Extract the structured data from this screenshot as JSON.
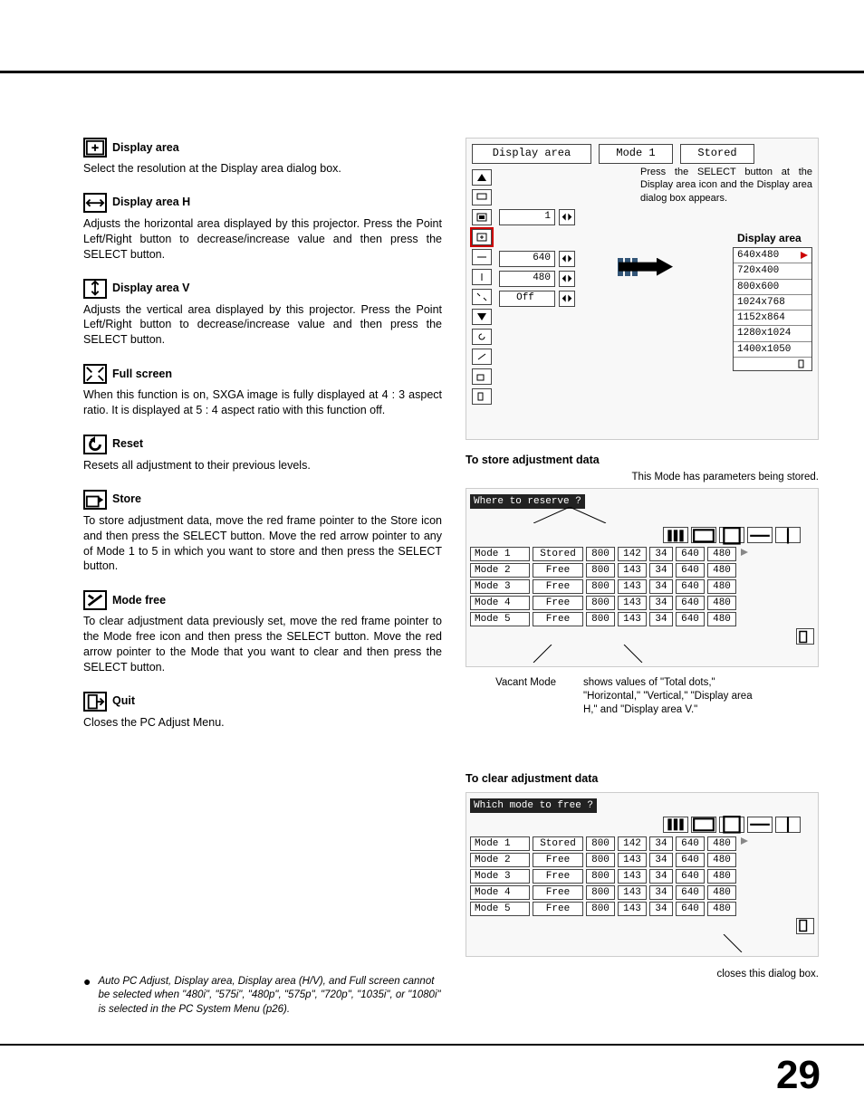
{
  "left": {
    "display_area": {
      "title": "Display area",
      "body": "Select the resolution at the Display area dialog box."
    },
    "display_area_h": {
      "title": "Display area H",
      "body": "Adjusts the horizontal area displayed by this projector.  Press the Point Left/Right button to decrease/increase value and then press the SELECT button."
    },
    "display_area_v": {
      "title": "Display area V",
      "body": "Adjusts the vertical area displayed by this projector.  Press the Point Left/Right button to decrease/increase value and then press the SELECT button."
    },
    "full_screen": {
      "title": "Full screen",
      "body": "When this function is on, SXGA image is fully displayed at 4 : 3 aspect ratio.  It is displayed at 5 : 4 aspect ratio with this function off."
    },
    "reset": {
      "title": "Reset",
      "body": "Resets all adjustment to their previous levels."
    },
    "store": {
      "title": "Store",
      "body": "To store adjustment data, move the red frame pointer to the Store icon and then press the SELECT button.  Move the red arrow pointer to any of Mode 1 to 5 in which you want to store  and then press the SELECT button."
    },
    "mode_free": {
      "title": "Mode free",
      "body": "To clear adjustment data previously set, move the red frame pointer to the Mode free icon and then press the SELECT button.  Move the red arrow pointer to the Mode that you want to clear and then press the SELECT button."
    },
    "quit": {
      "title": "Quit",
      "body": "Closes the PC Adjust Menu."
    },
    "footnote": "Auto PC Adjust, Display area, Display area (H/V), and Full screen cannot be selected when \"480i\", \"575i\", \"480p\", \"575p\", \"720p\", \"1035i\", or \"1080i\" is selected in the PC System Menu (p26)."
  },
  "right": {
    "osd": {
      "title_btn": "Display area",
      "mode_btn": "Mode 1",
      "stored_btn": "Stored",
      "callout": "Press the SELECT button at the Display area icon and the Display area dialog box appears.",
      "values": {
        "v1": "1",
        "v2": "640",
        "v3": "480",
        "v4": "Off"
      },
      "reslist_title": "Display area",
      "resolutions": [
        "640x480",
        "720x400",
        "800x600",
        "1024x768",
        "1152x864",
        "1280x1024",
        "1400x1050"
      ]
    },
    "store": {
      "heading": "To store adjustment data",
      "sub": "This Mode has parameters being stored.",
      "tbltitle": "Where to reserve ?",
      "rows": [
        {
          "mode": "Mode 1",
          "stat": "Stored",
          "v": [
            "800",
            "142",
            "34",
            "640",
            "480"
          ]
        },
        {
          "mode": "Mode 2",
          "stat": "Free",
          "v": [
            "800",
            "143",
            "34",
            "640",
            "480"
          ]
        },
        {
          "mode": "Mode 3",
          "stat": "Free",
          "v": [
            "800",
            "143",
            "34",
            "640",
            "480"
          ]
        },
        {
          "mode": "Mode 4",
          "stat": "Free",
          "v": [
            "800",
            "143",
            "34",
            "640",
            "480"
          ]
        },
        {
          "mode": "Mode 5",
          "stat": "Free",
          "v": [
            "800",
            "143",
            "34",
            "640",
            "480"
          ]
        }
      ],
      "annot_left": "Vacant Mode",
      "annot_right": "shows values of \"Total dots,\" \"Horizontal,\" \"Vertical,\" \"Display area H,\" and \"Display area V.\""
    },
    "clear": {
      "heading": "To clear adjustment data",
      "tbltitle": "Which mode to free ?",
      "rows": [
        {
          "mode": "Mode 1",
          "stat": "Stored",
          "v": [
            "800",
            "142",
            "34",
            "640",
            "480"
          ]
        },
        {
          "mode": "Mode 2",
          "stat": "Free",
          "v": [
            "800",
            "143",
            "34",
            "640",
            "480"
          ]
        },
        {
          "mode": "Mode 3",
          "stat": "Free",
          "v": [
            "800",
            "143",
            "34",
            "640",
            "480"
          ]
        },
        {
          "mode": "Mode 4",
          "stat": "Free",
          "v": [
            "800",
            "143",
            "34",
            "640",
            "480"
          ]
        },
        {
          "mode": "Mode 5",
          "stat": "Free",
          "v": [
            "800",
            "143",
            "34",
            "640",
            "480"
          ]
        }
      ],
      "closes": "closes this dialog box."
    }
  },
  "page_number": "29"
}
